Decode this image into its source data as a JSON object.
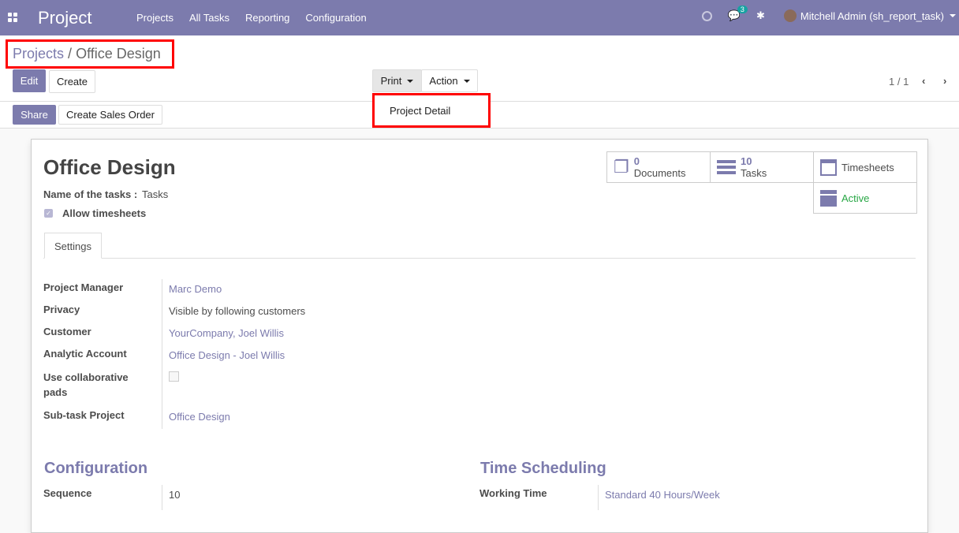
{
  "navbar": {
    "app_title": "Project",
    "menu": [
      "Projects",
      "All Tasks",
      "Reporting",
      "Configuration"
    ],
    "message_count": "3",
    "user": "Mitchell Admin (sh_report_task)"
  },
  "breadcrumb": {
    "parent": "Projects",
    "separator": "/",
    "current": "Office Design"
  },
  "buttons": {
    "edit": "Edit",
    "create": "Create",
    "print": "Print",
    "action": "Action",
    "share": "Share",
    "create_sales_order": "Create Sales Order"
  },
  "dropdown": {
    "items": [
      "Project Detail"
    ]
  },
  "pager": {
    "value": "1 / 1"
  },
  "form": {
    "title": "Office Design",
    "tasks_name_label": "Name of the tasks :",
    "tasks_name_value": "Tasks",
    "allow_timesheets_label": "Allow timesheets",
    "allow_timesheets": true,
    "stats": {
      "documents_count": "0",
      "documents_label": "Documents",
      "tasks_count": "10",
      "tasks_label": "Tasks",
      "timesheets_label": "Timesheets",
      "active_label": "Active",
      "active_color": "#28a745"
    },
    "tab": "Settings",
    "fields": [
      {
        "label": "Project Manager",
        "value": "Marc Demo"
      },
      {
        "label": "Privacy",
        "value": "Visible by following customers"
      },
      {
        "label": "Customer",
        "value": "YourCompany, Joel Willis"
      },
      {
        "label": "Analytic Account",
        "value": "Office Design - Joel Willis"
      },
      {
        "label": "Use collaborative pads",
        "value": ""
      },
      {
        "label": "Sub-task Project",
        "value": "Office Design"
      }
    ],
    "configuration": {
      "heading": "Configuration",
      "sequence_label": "Sequence",
      "sequence_value": "10"
    },
    "time_scheduling": {
      "heading": "Time Scheduling",
      "working_time_label": "Working Time",
      "working_time_value": "Standard 40 Hours/Week"
    }
  },
  "colors": {
    "brand": "#7c7bad",
    "highlight": "#ff0000"
  }
}
